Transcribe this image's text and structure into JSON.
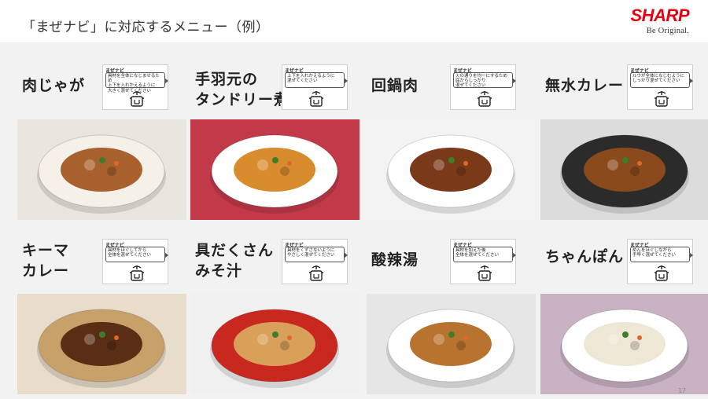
{
  "slide": {
    "title": "「まぜナビ」に対応するメニュー（例）",
    "page_number": "17"
  },
  "brand": {
    "logo_text": "SHARP",
    "tagline": "Be Original.",
    "color": "#e60012"
  },
  "bubble_header": "まぜナビ",
  "dishes": [
    {
      "name": "肉じゃが",
      "navi_text": "具材を全体になじませるため\n上下を入れかえるように\n大きく混ぜてください",
      "plate": "#f5f1e8",
      "food": "#a8612c",
      "bg": "#e9e6df"
    },
    {
      "name": "手羽元の\nタンドリー煮",
      "navi_text": "上下を入れかえるように\n混ぜてください",
      "plate": "#ffffff",
      "food": "#d98c2e",
      "bg": "#c23a4a"
    },
    {
      "name": "回鍋肉",
      "navi_text": "火の通りを均一にするため\n底からしっかり\n混ぜてください",
      "plate": "#ffffff",
      "food": "#7a3a1a",
      "bg": "#f3f3f3"
    },
    {
      "name": "無水カレー",
      "navi_text": "ルウが全体になじむように\nしっかり混ぜてください",
      "plate": "#2b2b2b",
      "food": "#8a4a1c",
      "bg": "#dcdcdc"
    },
    {
      "name": "キーマ\nカレー",
      "navi_text": "具材をほぐしてから\n全体を混ぜてください",
      "plate": "#c7a06a",
      "food": "#5a2e14",
      "bg": "#e8dccb"
    },
    {
      "name": "具だくさん\nみそ汁",
      "navi_text": "具材をくずさないように\nやさしく混ぜてください",
      "plate": "#c8281e",
      "food": "#d8a058",
      "bg": "#f0f0f0"
    },
    {
      "name": "酸辣湯",
      "navi_text": "具材を加えた後\n全体を混ぜてください",
      "plate": "#ffffff",
      "food": "#b8732e",
      "bg": "#e6e6e6"
    },
    {
      "name": "ちゃんぽん",
      "navi_text": "めんをほぐしながら\n手早く混ぜてください",
      "plate": "#ffffff",
      "food": "#efe7d6",
      "bg": "#c9b2c4"
    }
  ]
}
